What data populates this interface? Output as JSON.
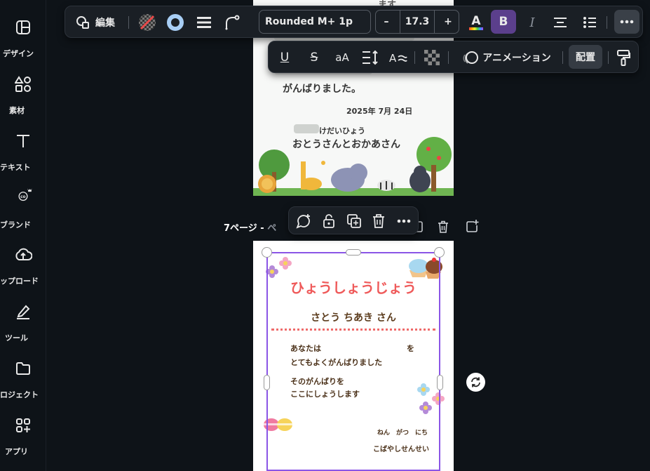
{
  "sidebar": {
    "items": [
      {
        "label": "デザイン",
        "icon": "layout-icon"
      },
      {
        "label": "素材",
        "icon": "elements-icon"
      },
      {
        "label": "テキスト",
        "icon": "text-icon"
      },
      {
        "label": "ブランド",
        "icon": "brand-icon"
      },
      {
        "label": "ップロード",
        "icon": "upload-icon"
      },
      {
        "label": "ツール",
        "icon": "draw-icon"
      },
      {
        "label": "ロジェクト",
        "icon": "folder-icon"
      },
      {
        "label": "アプリ",
        "icon": "apps-icon"
      }
    ]
  },
  "toolbar": {
    "edit_label": "編集",
    "font_name": "Rounded M+ 1p",
    "font_size": "17.3",
    "minus": "–",
    "plus": "+",
    "text_color_letter": "A",
    "bold_letter": "B",
    "italic_letter": "I"
  },
  "toolbar2": {
    "underline": "U",
    "strike": "S",
    "case": "aA",
    "animation_label": "アニメーション",
    "position_label": "配置"
  },
  "page1": {
    "line1": "ます",
    "line2": "がんばりました。",
    "date": "2025年 7月 24日",
    "small": "けだいひょう",
    "parents": "おとうさんとおかあさん"
  },
  "page_bar": {
    "label": "7ページ - ",
    "dim": "ペ"
  },
  "certificate": {
    "title": "ひょうしょうじょう",
    "name": "さとう ちあき さん",
    "line1": "あなたは",
    "line1_end": "を",
    "line2": "とてもよくがんばりました",
    "line3": "そのがんばりを",
    "line4": "ここにしょうします",
    "date": "ねん　がつ　にち",
    "teacher": "こばやしせんせい"
  },
  "colors": {
    "accent": "#8a55e6",
    "bold_bg": "#5b3f8c",
    "title_red": "#ef5a5a"
  }
}
